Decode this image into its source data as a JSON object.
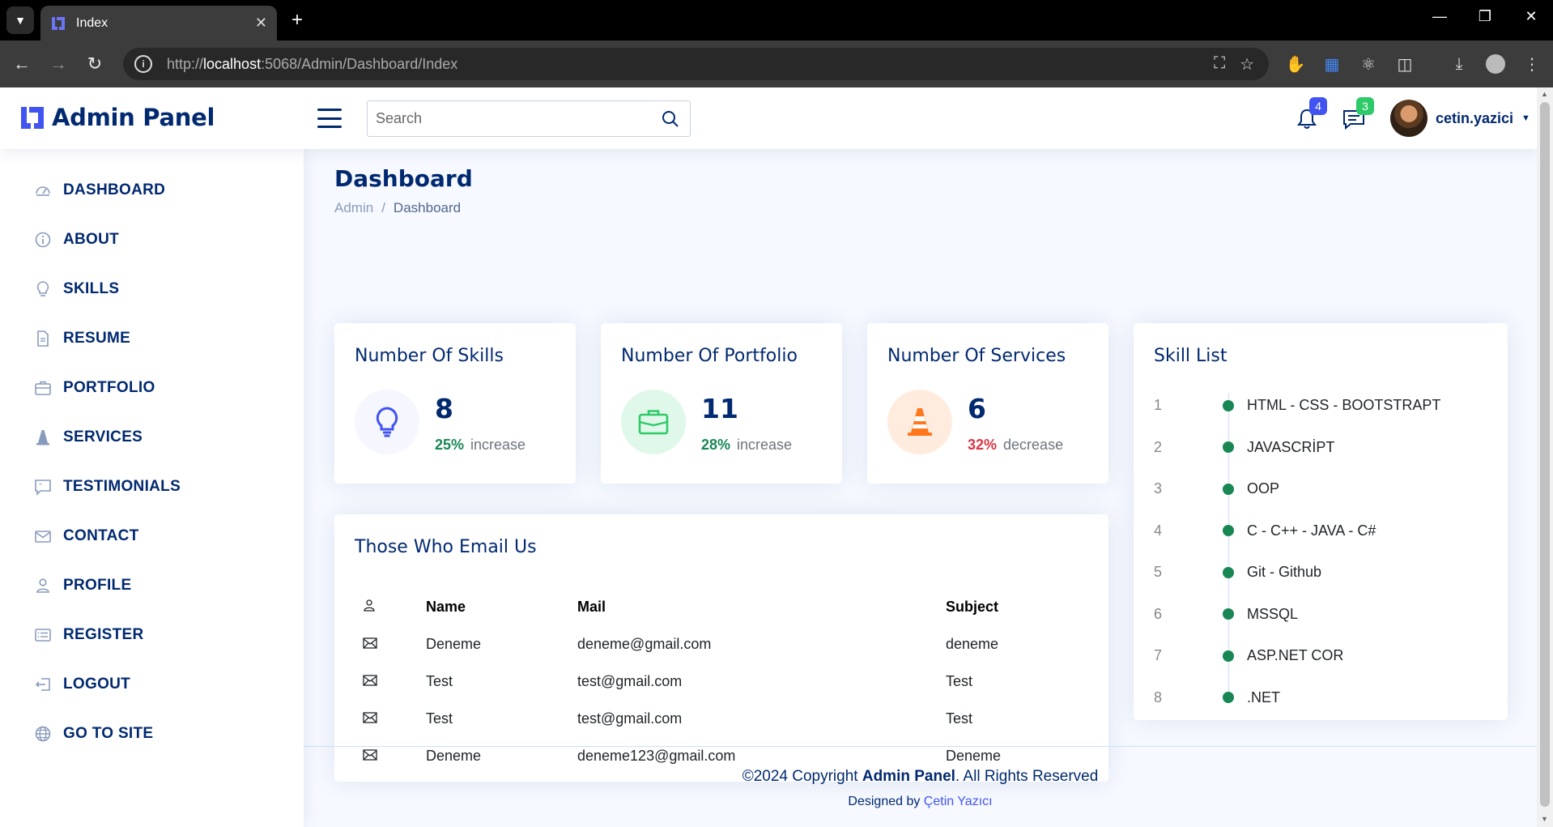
{
  "browser": {
    "tab_title": "Index",
    "url_host": "localhost",
    "url_rest": ":5068/Admin/Dashboard/Index",
    "url_scheme": "http://"
  },
  "header": {
    "brand": "Admin Panel",
    "search_placeholder": "Search",
    "notifications_count": "4",
    "messages_count": "3",
    "username": "cetin.yazici"
  },
  "sidebar": {
    "items": [
      {
        "label": "DASHBOARD",
        "icon": "speedometer-icon"
      },
      {
        "label": "ABOUT",
        "icon": "info-circle-icon"
      },
      {
        "label": "SKILLS",
        "icon": "lightbulb-icon"
      },
      {
        "label": "RESUME",
        "icon": "file-text-icon"
      },
      {
        "label": "PORTFOLIO",
        "icon": "briefcase-icon"
      },
      {
        "label": "SERVICES",
        "icon": "cone-icon"
      },
      {
        "label": "TESTIMONIALS",
        "icon": "chat-quote-icon"
      },
      {
        "label": "CONTACT",
        "icon": "envelope-icon"
      },
      {
        "label": "PROFILE",
        "icon": "person-icon"
      },
      {
        "label": "REGISTER",
        "icon": "card-list-icon"
      },
      {
        "label": "LOGOUT",
        "icon": "box-arrow-left-icon"
      },
      {
        "label": "GO TO SITE",
        "icon": "globe-icon"
      }
    ]
  },
  "page": {
    "title": "Dashboard",
    "breadcrumb": [
      "Admin",
      "Dashboard"
    ]
  },
  "cards": {
    "skills": {
      "title": "Number Of Skills",
      "value": "8",
      "pct": "25%",
      "change": "increase",
      "icon": "lightbulb-icon",
      "color": "#4154f1"
    },
    "portfolio": {
      "title": "Number Of Portfolio",
      "value": "11",
      "pct": "28%",
      "change": "increase",
      "icon": "briefcase-icon",
      "color": "#2eca6a"
    },
    "services": {
      "title": "Number Of Services",
      "value": "6",
      "pct": "32%",
      "change": "decrease",
      "icon": "cone-icon",
      "color": "#ff771d"
    }
  },
  "emails": {
    "title": "Those Who Email Us",
    "columns": [
      "Name",
      "Mail",
      "Subject"
    ],
    "rows": [
      {
        "name": "Deneme",
        "mail": "deneme@gmail.com",
        "subject": "deneme"
      },
      {
        "name": "Test",
        "mail": "test@gmail.com",
        "subject": "Test"
      },
      {
        "name": "Test",
        "mail": "test@gmail.com",
        "subject": "Test"
      },
      {
        "name": "Deneme",
        "mail": "deneme123@gmail.com",
        "subject": "Deneme"
      }
    ]
  },
  "skill_list": {
    "title": "Skill List",
    "items": [
      {
        "idx": "1",
        "name": "HTML - CSS - BOOTSTRAPT"
      },
      {
        "idx": "2",
        "name": "JAVASCRİPT"
      },
      {
        "idx": "3",
        "name": "OOP"
      },
      {
        "idx": "4",
        "name": "C - C++ - JAVA - C#"
      },
      {
        "idx": "5",
        "name": "Git - Github"
      },
      {
        "idx": "6",
        "name": "MSSQL"
      },
      {
        "idx": "7",
        "name": "ASP.NET COR"
      },
      {
        "idx": "8",
        "name": ".NET"
      }
    ]
  },
  "footer": {
    "copy_prefix": "©2024 Copyright ",
    "copy_brand": "Admin Panel",
    "copy_suffix": ". All Rights Reserved",
    "designed_by": "Designed by ",
    "designer": "Çetin Yazıcı"
  },
  "colors": {
    "primary": "#012970",
    "accent": "#4154f1",
    "success": "#198754",
    "danger": "#dc3545"
  }
}
